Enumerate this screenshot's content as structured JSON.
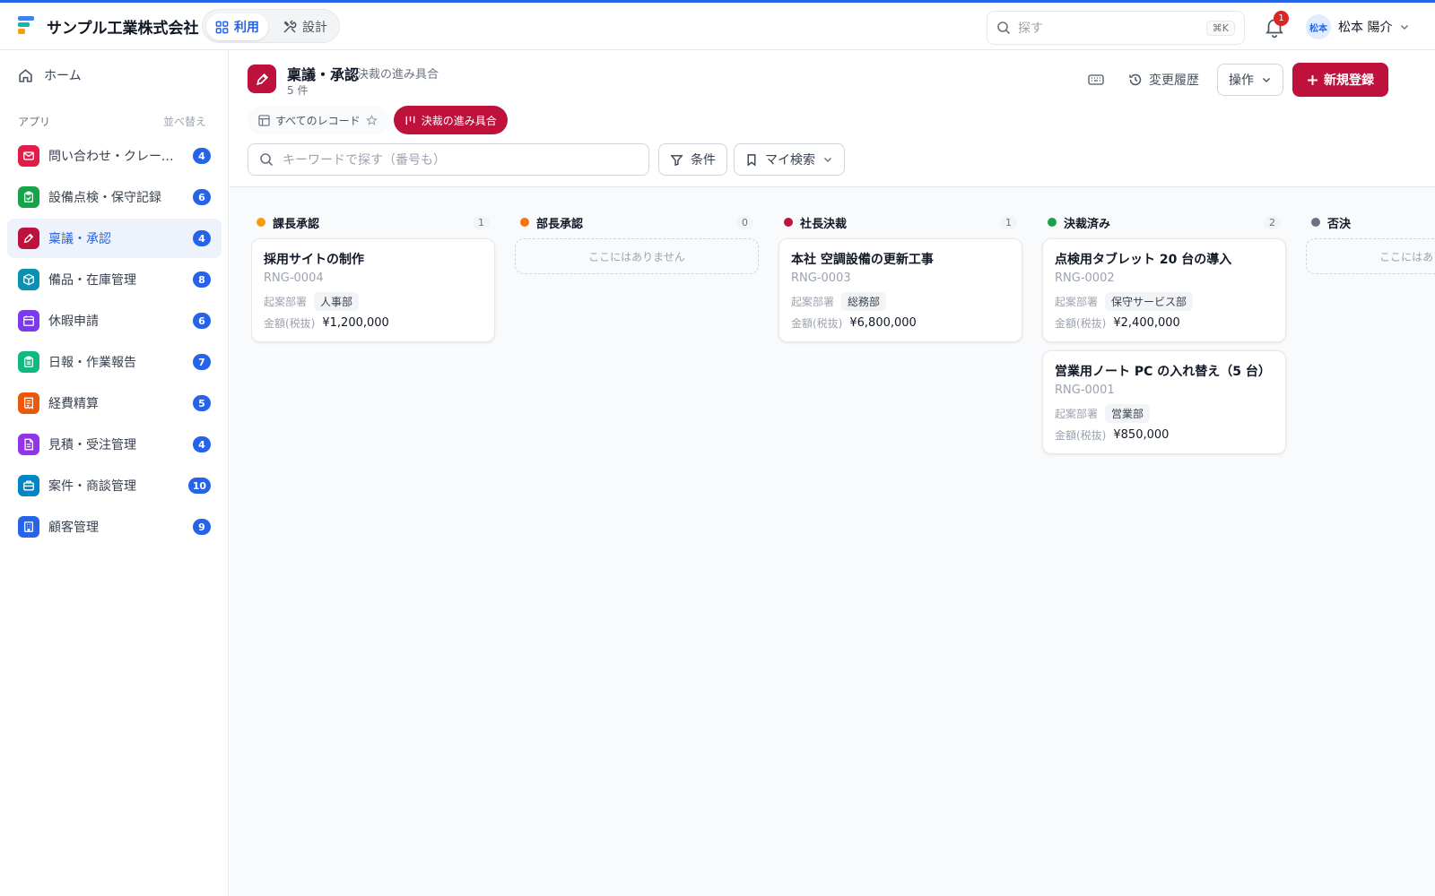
{
  "header": {
    "company": "サンプル工業株式会社",
    "modes": [
      {
        "label": "利用",
        "active": true
      },
      {
        "label": "設計",
        "active": false
      }
    ],
    "search_placeholder": "探す",
    "search_shortcut": "⌘K",
    "notification_count": "1",
    "user_initials": "松本",
    "user_name": "松本 陽介"
  },
  "sidebar": {
    "home_label": "ホーム",
    "apps_heading": "アプリ",
    "sort_label": "並べ替え",
    "apps": [
      {
        "label": "問い合わせ・クレーム管理",
        "count": "4",
        "color": "#e11d48",
        "icon": "mail-icon",
        "active": false
      },
      {
        "label": "設備点検・保守記録",
        "count": "6",
        "color": "#16a34a",
        "icon": "clipboard-check-icon",
        "active": false
      },
      {
        "label": "稟議・承認",
        "count": "4",
        "color": "#be123c",
        "icon": "pen-icon",
        "active": true
      },
      {
        "label": "備品・在庫管理",
        "count": "8",
        "color": "#0891b2",
        "icon": "package-icon",
        "active": false
      },
      {
        "label": "休暇申請",
        "count": "6",
        "color": "#7c3aed",
        "icon": "calendar-icon",
        "active": false
      },
      {
        "label": "日報・作業報告",
        "count": "7",
        "color": "#10b981",
        "icon": "clipboard-list-icon",
        "active": false
      },
      {
        "label": "経費精算",
        "count": "5",
        "color": "#ea580c",
        "icon": "receipt-icon",
        "active": false
      },
      {
        "label": "見積・受注管理",
        "count": "4",
        "color": "#9333ea",
        "icon": "file-text-icon",
        "active": false
      },
      {
        "label": "案件・商談管理",
        "count": "10",
        "color": "#0284c7",
        "icon": "briefcase-icon",
        "active": false
      },
      {
        "label": "顧客管理",
        "count": "9",
        "color": "#2563eb",
        "icon": "building-icon",
        "active": false
      }
    ]
  },
  "page": {
    "title": "稟議・承認",
    "subtitle": "決裁の進み具合",
    "count": "5 件",
    "history_label": "変更履歴",
    "ops_label": "操作",
    "new_label": "新規登録",
    "views": [
      {
        "label": "すべてのレコード",
        "active": false
      },
      {
        "label": "決裁の進み具合",
        "active": true
      }
    ],
    "search_placeholder": "キーワードで探す（番号も）",
    "filter_label": "条件",
    "saved_search_label": "マイ検索"
  },
  "board": {
    "dept_label": "起案部署",
    "amount_label": "金額(税抜)",
    "empty_text": "ここにはありません",
    "columns": [
      {
        "title": "課長承認",
        "count": "1",
        "color": "#f59e0b",
        "cards": [
          {
            "title": "採用サイトの制作",
            "id": "RNG-0004",
            "dept": "人事部",
            "amount": "¥1,200,000"
          }
        ]
      },
      {
        "title": "部長承認",
        "count": "0",
        "color": "#f97316",
        "cards": []
      },
      {
        "title": "社長決裁",
        "count": "1",
        "color": "#be123c",
        "cards": [
          {
            "title": "本社 空調設備の更新工事",
            "id": "RNG-0003",
            "dept": "総務部",
            "amount": "¥6,800,000"
          }
        ]
      },
      {
        "title": "決裁済み",
        "count": "2",
        "color": "#16a34a",
        "cards": [
          {
            "title": "点検用タブレット 20 台の導入",
            "id": "RNG-0002",
            "dept": "保守サービス部",
            "amount": "¥2,400,000"
          },
          {
            "title": "営業用ノート PC の入れ替え（5 台）",
            "id": "RNG-0001",
            "dept": "営業部",
            "amount": "¥850,000"
          }
        ]
      },
      {
        "title": "否決",
        "count": "",
        "color": "#6b7280",
        "cards": []
      }
    ]
  }
}
